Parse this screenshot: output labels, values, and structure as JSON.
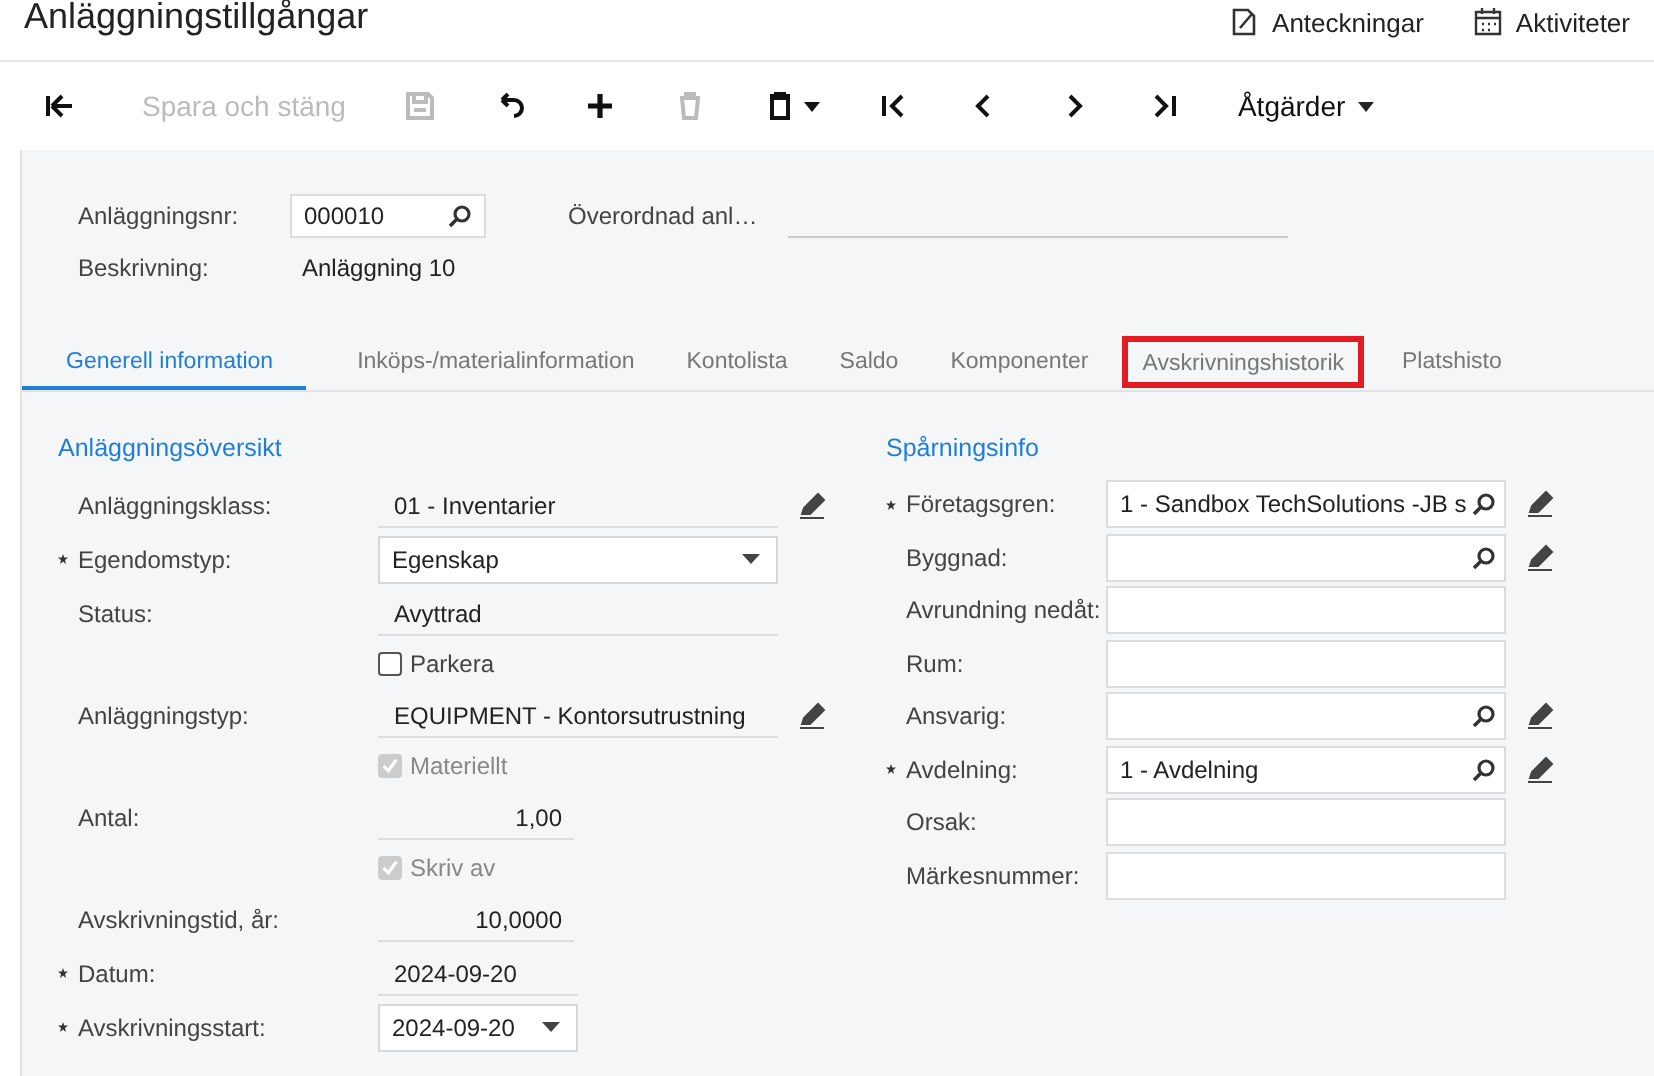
{
  "header": {
    "title": "Anläggningstillgångar",
    "links": [
      {
        "kind": "notes",
        "label": "Anteckningar"
      },
      {
        "kind": "calendar",
        "label": "Aktiviteter"
      }
    ]
  },
  "toolbar": [
    {
      "kind": "back",
      "disabled": false
    },
    {
      "kind": "text",
      "label": "Spara och stäng",
      "disabled": true
    },
    {
      "kind": "save",
      "disabled": true
    },
    {
      "kind": "undo",
      "disabled": false
    },
    {
      "kind": "add",
      "disabled": false
    },
    {
      "kind": "delete",
      "disabled": true
    },
    {
      "kind": "paste",
      "disabled": false
    },
    {
      "kind": "first",
      "disabled": false
    },
    {
      "kind": "prev",
      "disabled": false
    },
    {
      "kind": "next",
      "disabled": false
    },
    {
      "kind": "last",
      "disabled": false
    },
    {
      "kind": "menu",
      "label": "Åtgärder",
      "disabled": false
    }
  ],
  "summary": {
    "number_label": "Anläggningsnr:",
    "number_value": "000010",
    "parent_label": "Överordnad anl…",
    "description_label": "Beskrivning:",
    "description_value": "Anläggning 10"
  },
  "tabs": [
    {
      "label": "Generell information",
      "selected": true,
      "highlighted": false
    },
    {
      "label": "Inköps-/materialinformation",
      "selected": false,
      "highlighted": false
    },
    {
      "label": "Kontolista",
      "selected": false,
      "highlighted": false
    },
    {
      "label": "Saldo",
      "selected": false,
      "highlighted": false
    },
    {
      "label": "Komponenter",
      "selected": false,
      "highlighted": false
    },
    {
      "label": "Avskrivningshistorik",
      "selected": false,
      "highlighted": true
    },
    {
      "label": "Platshisto",
      "selected": false,
      "highlighted": false
    }
  ],
  "overview": {
    "title": "Anläggningsöversikt",
    "rows": [
      {
        "kind": "display",
        "label": "Anläggningsklass:",
        "value": "01 - Inventarier",
        "required": false,
        "editable": true
      },
      {
        "kind": "select",
        "label": "Egendomstyp:",
        "value": "Egenskap",
        "required": true
      },
      {
        "kind": "display",
        "label": "Status:",
        "value": "Avyttrad",
        "required": false,
        "editable": false
      },
      {
        "kind": "checkbox",
        "label": "Parkera",
        "checked": false,
        "disabled": false
      },
      {
        "kind": "display",
        "label": "Anläggningstyp:",
        "value": "EQUIPMENT - Kontorsutrustning",
        "required": false,
        "editable": true
      },
      {
        "kind": "checkbox",
        "label": "Materiellt",
        "checked": true,
        "disabled": true
      },
      {
        "kind": "number",
        "label": "Antal:",
        "value": "1,00",
        "required": false
      },
      {
        "kind": "checkbox",
        "label": "Skriv av",
        "checked": true,
        "disabled": true
      },
      {
        "kind": "number",
        "label": "Avskrivningstid, år:",
        "value": "10,0000",
        "required": false
      },
      {
        "kind": "date",
        "label": "Datum:",
        "value": "2024-09-20",
        "required": true
      },
      {
        "kind": "date-select",
        "label": "Avskrivningsstart:",
        "value": "2024-09-20",
        "required": true
      }
    ]
  },
  "tracking": {
    "title": "Spårningsinfo",
    "rows": [
      {
        "label": "Företagsgren:",
        "value": "1 - Sandbox TechSolutions -JB s",
        "required": true,
        "lookup": true,
        "editable": true
      },
      {
        "label": "Byggnad:",
        "required": false,
        "lookup": true,
        "editable": true
      },
      {
        "label": "Avrundning nedåt:",
        "required": false,
        "lookup": false,
        "editable": false
      },
      {
        "label": "Rum:",
        "required": false,
        "lookup": false,
        "editable": false
      },
      {
        "label": "Ansvarig:",
        "required": false,
        "lookup": true,
        "editable": true
      },
      {
        "label": "Avdelning:",
        "value": "1 - Avdelning",
        "required": true,
        "lookup": true,
        "editable": true
      },
      {
        "label": "Orsak:",
        "required": false,
        "lookup": false,
        "editable": false
      },
      {
        "label": "Märkesnummer:",
        "required": false,
        "lookup": false,
        "editable": false
      }
    ]
  }
}
